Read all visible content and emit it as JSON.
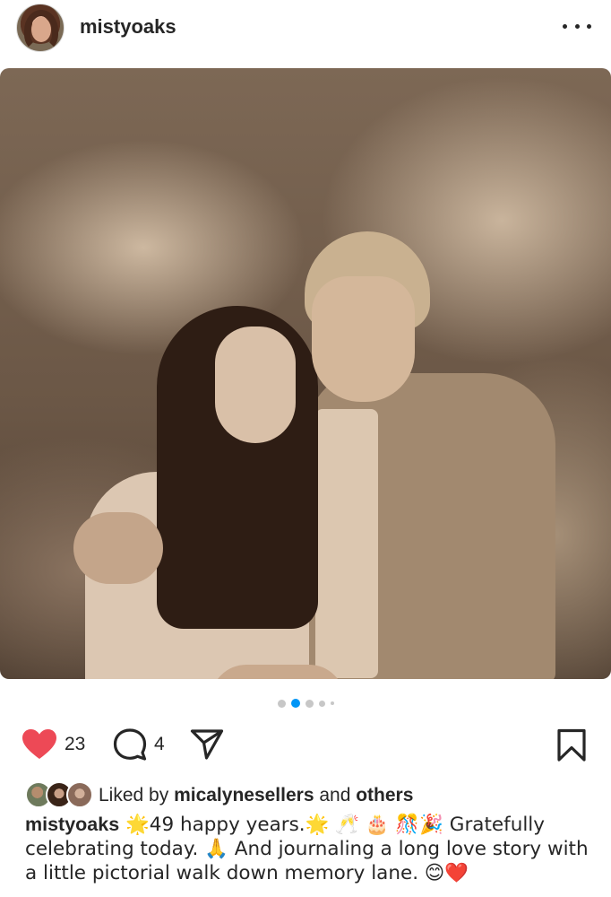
{
  "post": {
    "username": "mistyoaks",
    "more_icon": "more-horizontal-icon"
  },
  "carousel": {
    "active_index": 1,
    "dot_count": 5
  },
  "actions": {
    "like_count": "23",
    "comment_count": "4",
    "like_color": "#ed4956",
    "icons": [
      "heart-icon",
      "comment-icon",
      "share-icon",
      "bookmark-icon"
    ]
  },
  "likes": {
    "prefix": "Liked by ",
    "user": "micalynesellers",
    "middle": " and ",
    "others": "others"
  },
  "caption": {
    "username": "mistyoaks",
    "part1": " 🌟49 happy years.🌟 🥂 🎂 🎊🎉 Gratefully celebrating today. 🙏  And journaling a long love story with a little pictorial walk down memory lane. 😊❤️"
  },
  "colors": {
    "carousel_active": "#0095f6",
    "carousel_inactive": "#c7c7c7"
  }
}
